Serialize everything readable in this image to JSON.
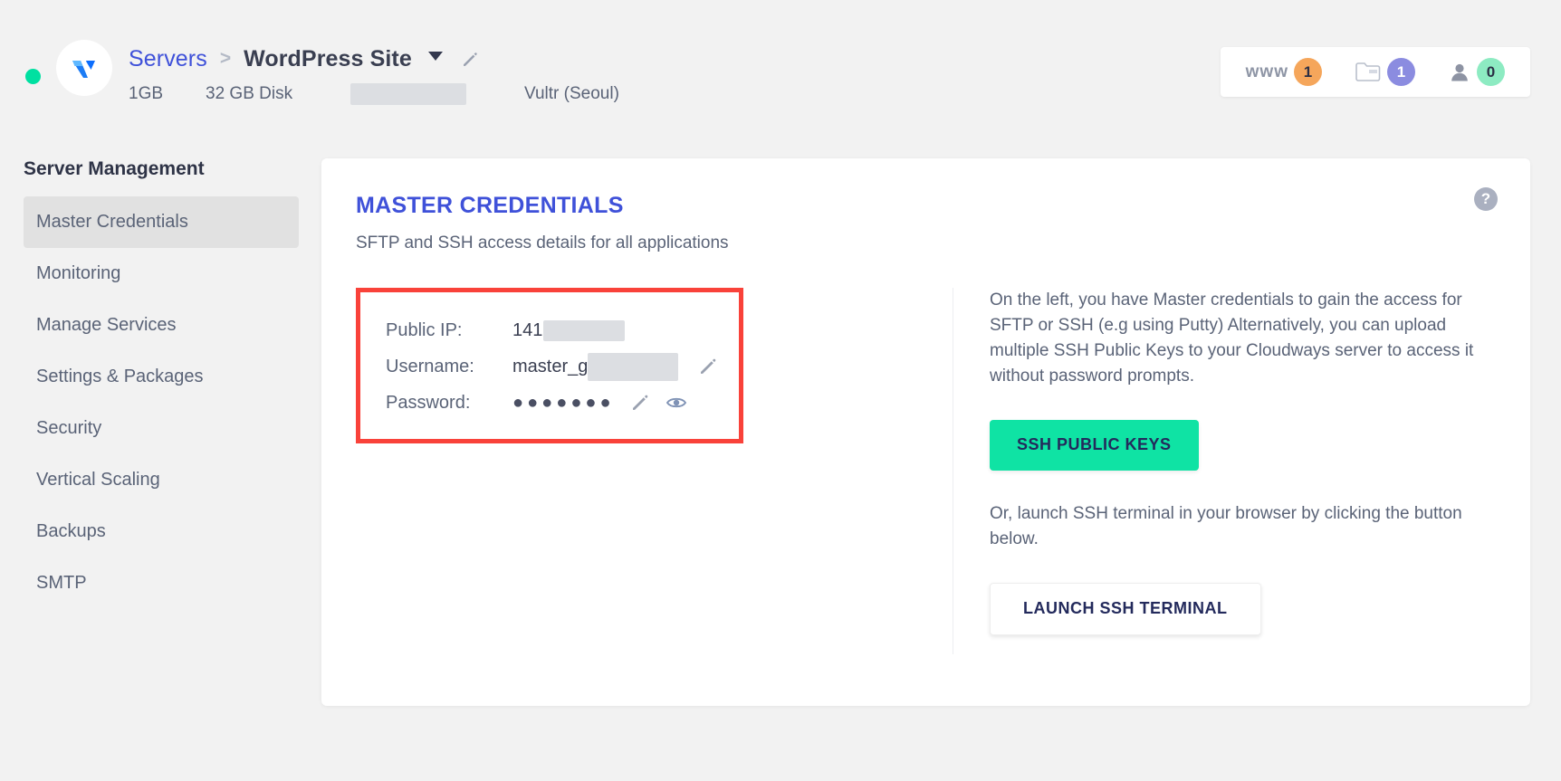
{
  "header": {
    "status": "online",
    "logo_name": "vultr-logo",
    "breadcrumb": {
      "parent": "Servers",
      "separator": ">",
      "current": "WordPress Site"
    },
    "specs": {
      "ram": "1GB",
      "disk": "32 GB Disk",
      "redacted_label": "",
      "provider": "Vultr (Seoul)"
    },
    "counters": [
      {
        "name": "www-counter",
        "label": "www",
        "value": "1",
        "color": "#f5a65b"
      },
      {
        "name": "database-counter",
        "label": "",
        "value": "1",
        "color": "#8b8ce0"
      },
      {
        "name": "users-counter",
        "label": "",
        "value": "0",
        "color": "#8debc2"
      }
    ]
  },
  "sidebar": {
    "title": "Server Management",
    "items": [
      {
        "label": "Master Credentials",
        "active": true
      },
      {
        "label": "Monitoring",
        "active": false
      },
      {
        "label": "Manage Services",
        "active": false
      },
      {
        "label": "Settings & Packages",
        "active": false
      },
      {
        "label": "Security",
        "active": false
      },
      {
        "label": "Vertical Scaling",
        "active": false
      },
      {
        "label": "Backups",
        "active": false
      },
      {
        "label": "SMTP",
        "active": false
      }
    ]
  },
  "card": {
    "title": "MASTER CREDENTIALS",
    "subtitle": "SFTP and SSH access details for all applications",
    "help_glyph": "?",
    "credentials": {
      "public_ip": {
        "label": "Public IP:",
        "value": "141"
      },
      "username": {
        "label": "Username:",
        "value": "master_g"
      },
      "password": {
        "label": "Password:",
        "value": "●●●●●●●"
      }
    },
    "right": {
      "paragraph": "On the left, you have Master credentials to gain the access for SFTP or SSH (e.g using Putty) Alternatively, you can upload multiple SSH Public Keys to your Cloudways server to access it without password prompts.",
      "ssh_keys_button": "SSH PUBLIC KEYS",
      "paragraph2": "Or, launch SSH terminal in your browser by clicking the button below.",
      "terminal_button": "LAUNCH SSH TERMINAL"
    }
  },
  "colors": {
    "accent_blue": "#3f51d9",
    "accent_green": "#0fe3a4",
    "annotation_red": "#f9423a",
    "status_green": "#00e0a1"
  }
}
